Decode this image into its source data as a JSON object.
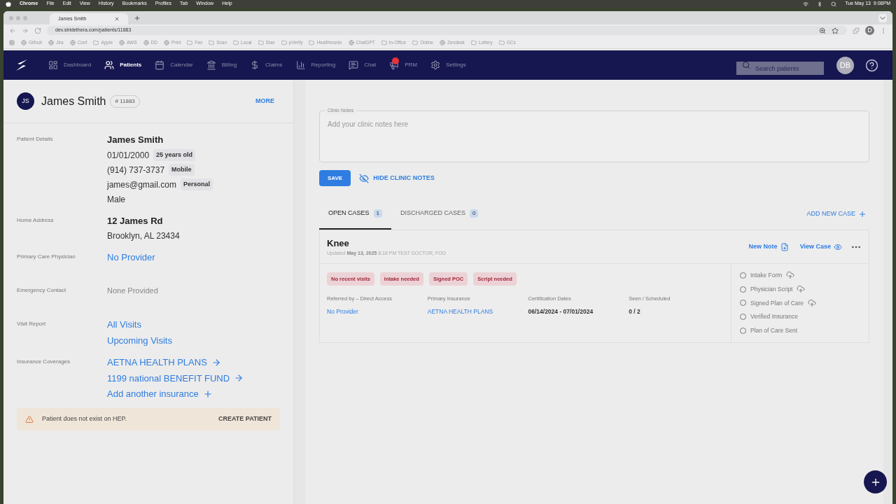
{
  "menubar": {
    "items": [
      {
        "label": "Chrome",
        "bold": true
      },
      {
        "label": "File",
        "bold": false
      },
      {
        "label": "Edit",
        "bold": false
      },
      {
        "label": "View",
        "bold": false
      },
      {
        "label": "History",
        "bold": false
      },
      {
        "label": "Bookmarks",
        "bold": false
      },
      {
        "label": "Profiles",
        "bold": false
      },
      {
        "label": "Tab",
        "bold": false
      },
      {
        "label": "Window",
        "bold": false
      },
      {
        "label": "Help",
        "bold": false
      }
    ],
    "clock": "Tue May 13  9:08PM"
  },
  "browser": {
    "tab_title": "James Smith",
    "url": "dev.stridethera.com/patients/11883",
    "avatar": "D",
    "bookmarks": [
      {
        "label": "Github",
        "kind": "site"
      },
      {
        "label": "Jira",
        "kind": "site"
      },
      {
        "label": "Conf",
        "kind": "site"
      },
      {
        "label": "Apple",
        "kind": "folder"
      },
      {
        "label": "AWS",
        "kind": "site"
      },
      {
        "label": "DD",
        "kind": "site"
      },
      {
        "label": "Print",
        "kind": "site"
      },
      {
        "label": "Fax",
        "kind": "folder"
      },
      {
        "label": "Scan",
        "kind": "folder"
      },
      {
        "label": "Local",
        "kind": "folder"
      },
      {
        "label": "Stax",
        "kind": "folder"
      },
      {
        "label": "pVerify",
        "kind": "folder"
      },
      {
        "label": "Healthmonix",
        "kind": "folder"
      },
      {
        "label": "ChatGPT",
        "kind": "site"
      },
      {
        "label": "In-Office",
        "kind": "folder"
      },
      {
        "label": "Online",
        "kind": "folder"
      },
      {
        "label": "Zendesk",
        "kind": "site"
      },
      {
        "label": "Lottery",
        "kind": "folder"
      },
      {
        "label": "GCs",
        "kind": "folder"
      }
    ]
  },
  "nav": {
    "items": [
      {
        "label": "Dashboard",
        "selected": false,
        "badge": false
      },
      {
        "label": "Patients",
        "selected": true,
        "badge": false
      },
      {
        "label": "Calendar",
        "selected": false,
        "badge": false
      },
      {
        "label": "Billing",
        "selected": false,
        "badge": false
      },
      {
        "label": "Claims",
        "selected": false,
        "badge": false
      },
      {
        "label": "Reporting",
        "selected": false,
        "badge": false
      },
      {
        "label": "Chat",
        "selected": false,
        "badge": false
      },
      {
        "label": "PRM",
        "selected": false,
        "badge": true
      },
      {
        "label": "Settings",
        "selected": false,
        "badge": false
      }
    ],
    "search": {
      "placeholder": "Search patients"
    },
    "avatar": "DB"
  },
  "patient": {
    "initials": "JS",
    "name": "James Smith",
    "id": "# 11883",
    "more": "MORE",
    "details": [
      {
        "label": "Patient Details",
        "lines": [
          {
            "text": "James Smith",
            "kind": "bold"
          },
          {
            "text": "01/01/2000",
            "kind": "plain",
            "tag": "25 years old"
          },
          {
            "text": "(914) 737-3737",
            "kind": "plain",
            "tag": "Mobile"
          },
          {
            "text": "james@gmail.com",
            "kind": "plain",
            "tag": "Personal"
          },
          {
            "text": "Male",
            "kind": "plain"
          }
        ]
      },
      {
        "label": "Home Address",
        "lines": [
          {
            "text": "12 James Rd",
            "kind": "bold"
          },
          {
            "text": "Brooklyn, AL 23434",
            "kind": "plain"
          }
        ]
      },
      {
        "label": "Primary Care Physician",
        "lines": [
          {
            "text": "No Provider",
            "kind": "link"
          }
        ]
      },
      {
        "label": "Emergency Contact",
        "lines": [
          {
            "text": "None Provided",
            "kind": "muted"
          }
        ]
      },
      {
        "label": "Visit Report",
        "lines": [
          {
            "text": "All Visits",
            "kind": "link"
          },
          {
            "text": "Upcoming Visits",
            "kind": "link"
          }
        ]
      },
      {
        "label": "Insurance Coverages",
        "lines": [
          {
            "text": "AETNA HEALTH PLANS",
            "kind": "link_arrow"
          },
          {
            "text": "1199 national BENEFIT FUND",
            "kind": "link_arrow"
          },
          {
            "text": "Add another insurance",
            "kind": "link_plus"
          }
        ]
      }
    ],
    "alert": {
      "text": "Patient does not exist on HEP.",
      "action": "CREATE PATIENT"
    }
  },
  "clinic_notes": {
    "label": "Clinic Notes",
    "placeholder": "Add your clinic notes here",
    "save": "SAVE",
    "hide": "HIDE CLINIC NOTES"
  },
  "case_tabs": [
    {
      "label": "OPEN CASES",
      "count": "1",
      "selected": true
    },
    {
      "label": "DISCHARGED CASES",
      "count": "0",
      "selected": false
    }
  ],
  "add_case": "ADD NEW CASE",
  "case": {
    "title": "Knee",
    "updated_label": "Updated",
    "updated_date": "May 13, 2025",
    "updated_time": "8:18 PM",
    "updated_by": "TEST DOCTOR, FOO",
    "new_note": "New Note",
    "view_case": "View Case",
    "tags": [
      "No recent visits",
      "Intake needed",
      "Signed POC",
      "Script needed"
    ],
    "fields": [
      {
        "label": "Referred by – Direct Access",
        "value": "No Provider",
        "kind": "link"
      },
      {
        "label": "Primary Insurance",
        "value": "AETNA HEALTH PLANS",
        "kind": "link"
      },
      {
        "label": "Certification Dates",
        "value": "06/14/2024 - 07/01/2024",
        "kind": "plain"
      },
      {
        "label": "Seen / Scheduled",
        "value": "0 / 2",
        "kind": "plain"
      }
    ],
    "checklist": [
      {
        "label": "Intake Form",
        "checked": false,
        "upload": true
      },
      {
        "label": "Physician Script",
        "checked": false,
        "upload": true
      },
      {
        "label": "Signed Plan of Care",
        "checked": false,
        "upload": true
      },
      {
        "label": "Verified Insurance",
        "checked": false,
        "upload": false
      },
      {
        "label": "Plan of Care Sent",
        "checked": false,
        "upload": false
      }
    ]
  }
}
